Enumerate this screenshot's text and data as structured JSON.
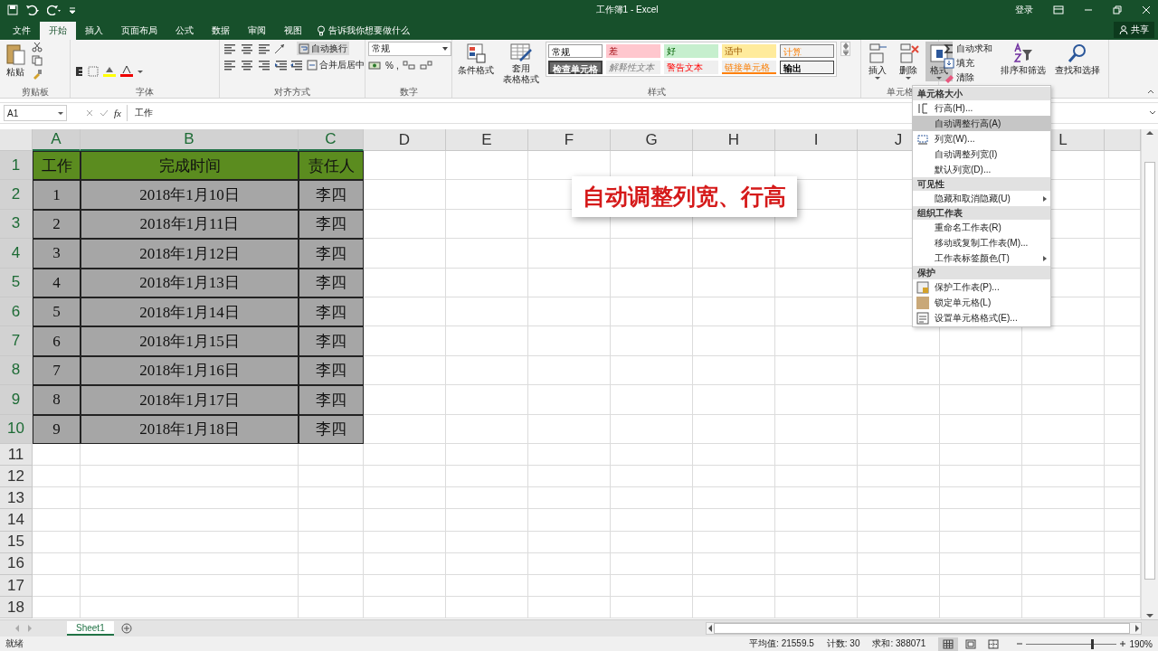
{
  "window": {
    "title": "工作簿1 - Excel",
    "sign_in": "登录"
  },
  "tabs": [
    {
      "label": "文件",
      "selected": false
    },
    {
      "label": "开始",
      "selected": true
    },
    {
      "label": "插入",
      "selected": false
    },
    {
      "label": "页面布局",
      "selected": false
    },
    {
      "label": "公式",
      "selected": false
    },
    {
      "label": "数据",
      "selected": false
    },
    {
      "label": "审阅",
      "selected": false
    },
    {
      "label": "视图",
      "selected": false
    }
  ],
  "tell_me": "告诉我你想要做什么",
  "share": "共享",
  "ribbon": {
    "groups": [
      {
        "kind": "clipboard",
        "label": "剪贴板",
        "paste": "粘贴"
      },
      {
        "kind": "font",
        "label": "字体"
      },
      {
        "kind": "alignment",
        "label": "对齐方式",
        "wrap": "自动换行",
        "merge": "合并后居中"
      },
      {
        "kind": "number",
        "label": "数字",
        "format": "常规",
        "percent": "%",
        "comma": ","
      },
      {
        "kind": "styles",
        "label": "样式",
        "conditional": "条件格式",
        "table_format": [
          "套用",
          "表格格式"
        ],
        "cell_styles": [
          {
            "label": "常规",
            "kind": "normal"
          },
          {
            "label": "差",
            "kind": "bad"
          },
          {
            "label": "好",
            "kind": "good"
          },
          {
            "label": "适中",
            "kind": "neutral"
          },
          {
            "label": "计算",
            "kind": "calc"
          },
          {
            "label": "检查单元格",
            "kind": "check"
          },
          {
            "label": "解释性文本",
            "kind": "note"
          },
          {
            "label": "警告文本",
            "kind": "warn"
          },
          {
            "label": "链接单元格",
            "kind": "linked"
          },
          {
            "label": "输出",
            "kind": "output"
          }
        ]
      },
      {
        "kind": "cells",
        "label": "单元格",
        "buttons": [
          {
            "label": "插入",
            "kind": "insert",
            "selected": false
          },
          {
            "label": "删除",
            "kind": "delete",
            "selected": false
          },
          {
            "label": "格式",
            "kind": "format",
            "selected": true
          }
        ]
      },
      {
        "kind": "editing",
        "autosum": "自动求和",
        "fill": "填充",
        "clear": "清除",
        "sort": "排序和筛选",
        "find": "查找和选择"
      }
    ]
  },
  "formula_bar": {
    "name_box": "A1",
    "function_label": "fx",
    "value": "工作"
  },
  "grid": {
    "columns": [
      {
        "label": "A",
        "selected": true
      },
      {
        "label": "B",
        "selected": true
      },
      {
        "label": "C",
        "selected": true
      },
      {
        "label": "D",
        "selected": false
      },
      {
        "label": "E",
        "selected": false
      },
      {
        "label": "F",
        "selected": false
      },
      {
        "label": "G",
        "selected": false
      },
      {
        "label": "H",
        "selected": false
      },
      {
        "label": "I",
        "selected": false
      },
      {
        "label": "J",
        "selected": false
      },
      {},
      {
        "label": "L",
        "selected": false
      }
    ],
    "rows": [
      {
        "label": "1",
        "selected": true
      },
      {
        "label": "2",
        "selected": true
      },
      {
        "label": "3",
        "selected": true
      },
      {
        "label": "4",
        "selected": true
      },
      {
        "label": "5",
        "selected": true
      },
      {
        "label": "6",
        "selected": true
      },
      {
        "label": "7",
        "selected": true
      },
      {
        "label": "8",
        "selected": true
      },
      {
        "label": "9",
        "selected": true
      },
      {
        "label": "10",
        "selected": true
      },
      {
        "label": "11",
        "selected": false
      },
      {
        "label": "12",
        "selected": false
      },
      {
        "label": "13",
        "selected": false
      },
      {
        "label": "14",
        "selected": false
      },
      {
        "label": "15",
        "selected": false
      },
      {
        "label": "16",
        "selected": false
      },
      {
        "label": "17",
        "selected": false
      },
      {
        "label": "18",
        "selected": false
      }
    ]
  },
  "table": {
    "header": [
      "工作",
      "完成时间",
      "责任人"
    ],
    "rows": [
      [
        "1",
        "2018年1月10日",
        "李四"
      ],
      [
        "2",
        "2018年1月11日",
        "李四"
      ],
      [
        "3",
        "2018年1月12日",
        "李四"
      ],
      [
        "4",
        "2018年1月13日",
        "李四"
      ],
      [
        "5",
        "2018年1月14日",
        "李四"
      ],
      [
        "6",
        "2018年1月15日",
        "李四"
      ],
      [
        "7",
        "2018年1月16日",
        "李四"
      ],
      [
        "8",
        "2018年1月17日",
        "李四"
      ],
      [
        "9",
        "2018年1月18日",
        "李四"
      ]
    ]
  },
  "caption": "自动调整列宽、行高",
  "format_menu": {
    "sections": [
      {
        "title": "单元格大小",
        "items": [
          {
            "label": "行高(H)...",
            "kind": "row-height",
            "selected": false,
            "submenu": false
          },
          {
            "label": "自动调整行高(A)",
            "kind": "plain",
            "selected": true,
            "submenu": false
          },
          {
            "label": "列宽(W)...",
            "kind": "column-width",
            "selected": false,
            "submenu": false
          },
          {
            "label": "自动调整列宽(I)",
            "kind": "plain",
            "selected": false,
            "submenu": false
          },
          {
            "label": "默认列宽(D)...",
            "kind": "plain",
            "selected": false,
            "submenu": false
          }
        ]
      },
      {
        "title": "可见性",
        "items": [
          {
            "label": "隐藏和取消隐藏(U)",
            "kind": "plain",
            "selected": false,
            "submenu": true
          }
        ]
      },
      {
        "title": "组织工作表",
        "items": [
          {
            "label": "重命名工作表(R)",
            "kind": "plain",
            "selected": false,
            "submenu": false
          },
          {
            "label": "移动或复制工作表(M)...",
            "kind": "plain",
            "selected": false,
            "submenu": false
          },
          {
            "label": "工作表标签颜色(T)",
            "kind": "plain",
            "selected": false,
            "submenu": true
          }
        ]
      },
      {
        "title": "保护",
        "items": [
          {
            "label": "保护工作表(P)...",
            "kind": "protect",
            "selected": false,
            "submenu": false
          },
          {
            "label": "锁定单元格(L)",
            "kind": "lock",
            "selected": false,
            "submenu": false
          },
          {
            "label": "设置单元格格式(E)...",
            "kind": "format-cells",
            "selected": false,
            "submenu": false
          }
        ]
      }
    ]
  },
  "sheets": [
    {
      "label": "Sheet1",
      "selected": true
    }
  ],
  "status_bar": {
    "ready": "就绪",
    "stats": [
      "平均值: 21559.5",
      "计数: 30",
      "求和: 388071"
    ],
    "views": [
      {
        "kind": "normal",
        "selected": true
      },
      {
        "kind": "layout",
        "selected": false
      },
      {
        "kind": "break",
        "selected": false
      }
    ],
    "zoom": {
      "level": 0.72,
      "value": "190%"
    }
  }
}
